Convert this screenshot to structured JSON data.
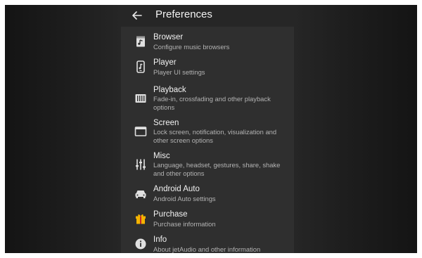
{
  "header": {
    "title": "Preferences"
  },
  "colors": {
    "panel_bg": "#2f2f2f",
    "appbar_bg": "#262626",
    "title_text": "#f2f2f2",
    "desc_text": "#b3b3b3",
    "purchase_icon": "#f4b400"
  },
  "items": [
    {
      "label": "Browser",
      "description": "Configure music browsers",
      "icon": "browser-icon"
    },
    {
      "label": "Player",
      "description": "Player UI settings",
      "icon": "player-icon"
    },
    {
      "label": "Playback",
      "description": "Fade-in, crossfading and other playback options",
      "icon": "playback-icon"
    },
    {
      "label": "Screen",
      "description": "Lock screen, notification, visualization and other screen options",
      "icon": "screen-icon"
    },
    {
      "label": "Misc",
      "description": "Language, headset, gestures, share, shake and other options",
      "icon": "equalizer-icon"
    },
    {
      "label": "Android Auto",
      "description": "Android Auto settings",
      "icon": "car-icon"
    },
    {
      "label": "Purchase",
      "description": "Purchase information",
      "icon": "gift-icon"
    },
    {
      "label": "Info",
      "description": "About jetAudio and other information",
      "icon": "info-icon"
    }
  ]
}
